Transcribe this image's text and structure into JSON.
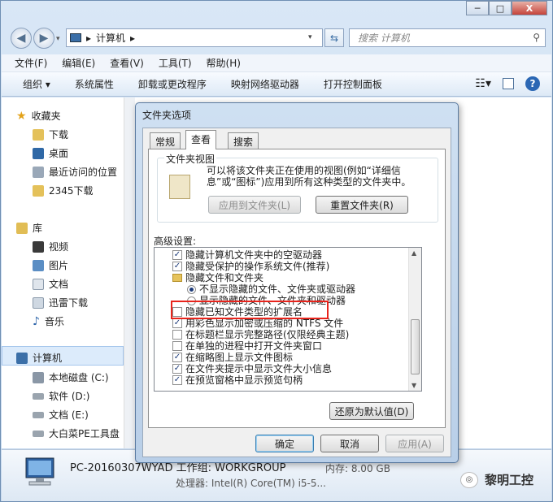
{
  "window": {
    "caption_minimize": "─",
    "caption_maximize": "□",
    "caption_close": "X"
  },
  "address": {
    "crumb_separator": "▸",
    "location": "计算机",
    "search_placeholder": "搜索 计算机"
  },
  "menu": [
    "文件(F)",
    "编辑(E)",
    "查看(V)",
    "工具(T)",
    "帮助(H)"
  ],
  "toolbar": [
    "组织 ▾",
    "系统属性",
    "卸载或更改程序",
    "映射网络驱动器",
    "打开控制面板"
  ],
  "sidebar": {
    "favorites": "收藏夹",
    "fav_items": [
      "下载",
      "桌面",
      "最近访问的位置",
      "2345下载"
    ],
    "library": "库",
    "lib_items": [
      "视频",
      "图片",
      "文档",
      "迅雷下载",
      "音乐"
    ],
    "computer": "计算机",
    "drives": [
      "本地磁盘 (C:)",
      "软件 (D:)",
      "文档 (E:)",
      "大白菜PE工具盘"
    ]
  },
  "details": {
    "pc_name": "PC-20160307WYAD  工作组: WORKGROUP",
    "memory": "内存: 8.00 GB",
    "cpu": "处理器: Intel(R) Core(TM) i5-5..."
  },
  "dialog": {
    "title": "文件夹选项",
    "tabs": [
      "常规",
      "查看",
      "搜索"
    ],
    "folder_view_label": "文件夹视图",
    "folder_view_text": "可以将该文件夹正在使用的视图(例如“详细信息”或“图标”)应用到所有这种类型的文件夹中。",
    "apply_to_folders": "应用到文件夹(L)",
    "reset_folders": "重置文件夹(R)",
    "advanced_label": "高级设置:",
    "tree": [
      {
        "type": "check",
        "checked": true,
        "indent": 1,
        "label": "隐藏计算机文件夹中的空驱动器"
      },
      {
        "type": "check",
        "checked": true,
        "indent": 1,
        "label": "隐藏受保护的操作系统文件(推荐)"
      },
      {
        "type": "folder",
        "indent": 1,
        "label": "隐藏文件和文件夹"
      },
      {
        "type": "radio",
        "checked": true,
        "indent": 2,
        "label": "不显示隐藏的文件、文件夹或驱动器"
      },
      {
        "type": "radio",
        "checked": false,
        "indent": 2,
        "label": "显示隐藏的文件、文件夹和驱动器"
      },
      {
        "type": "check",
        "checked": false,
        "indent": 1,
        "label": "隐藏已知文件类型的扩展名"
      },
      {
        "type": "check",
        "checked": true,
        "indent": 1,
        "label": "用彩色显示加密或压缩的 NTFS 文件"
      },
      {
        "type": "check",
        "checked": false,
        "indent": 1,
        "label": "在标题栏显示完整路径(仅限经典主题)"
      },
      {
        "type": "check",
        "checked": false,
        "indent": 1,
        "label": "在单独的进程中打开文件夹窗口"
      },
      {
        "type": "check",
        "checked": true,
        "indent": 1,
        "label": "在缩略图上显示文件图标"
      },
      {
        "type": "check",
        "checked": true,
        "indent": 1,
        "label": "在文件夹提示中显示文件大小信息"
      },
      {
        "type": "check",
        "checked": true,
        "indent": 1,
        "label": "在预览窗格中显示预览句柄"
      }
    ],
    "restore_defaults": "还原为默认值(D)",
    "ok": "确定",
    "cancel": "取消",
    "apply": "应用(A)"
  },
  "watermark": "黎明工控"
}
